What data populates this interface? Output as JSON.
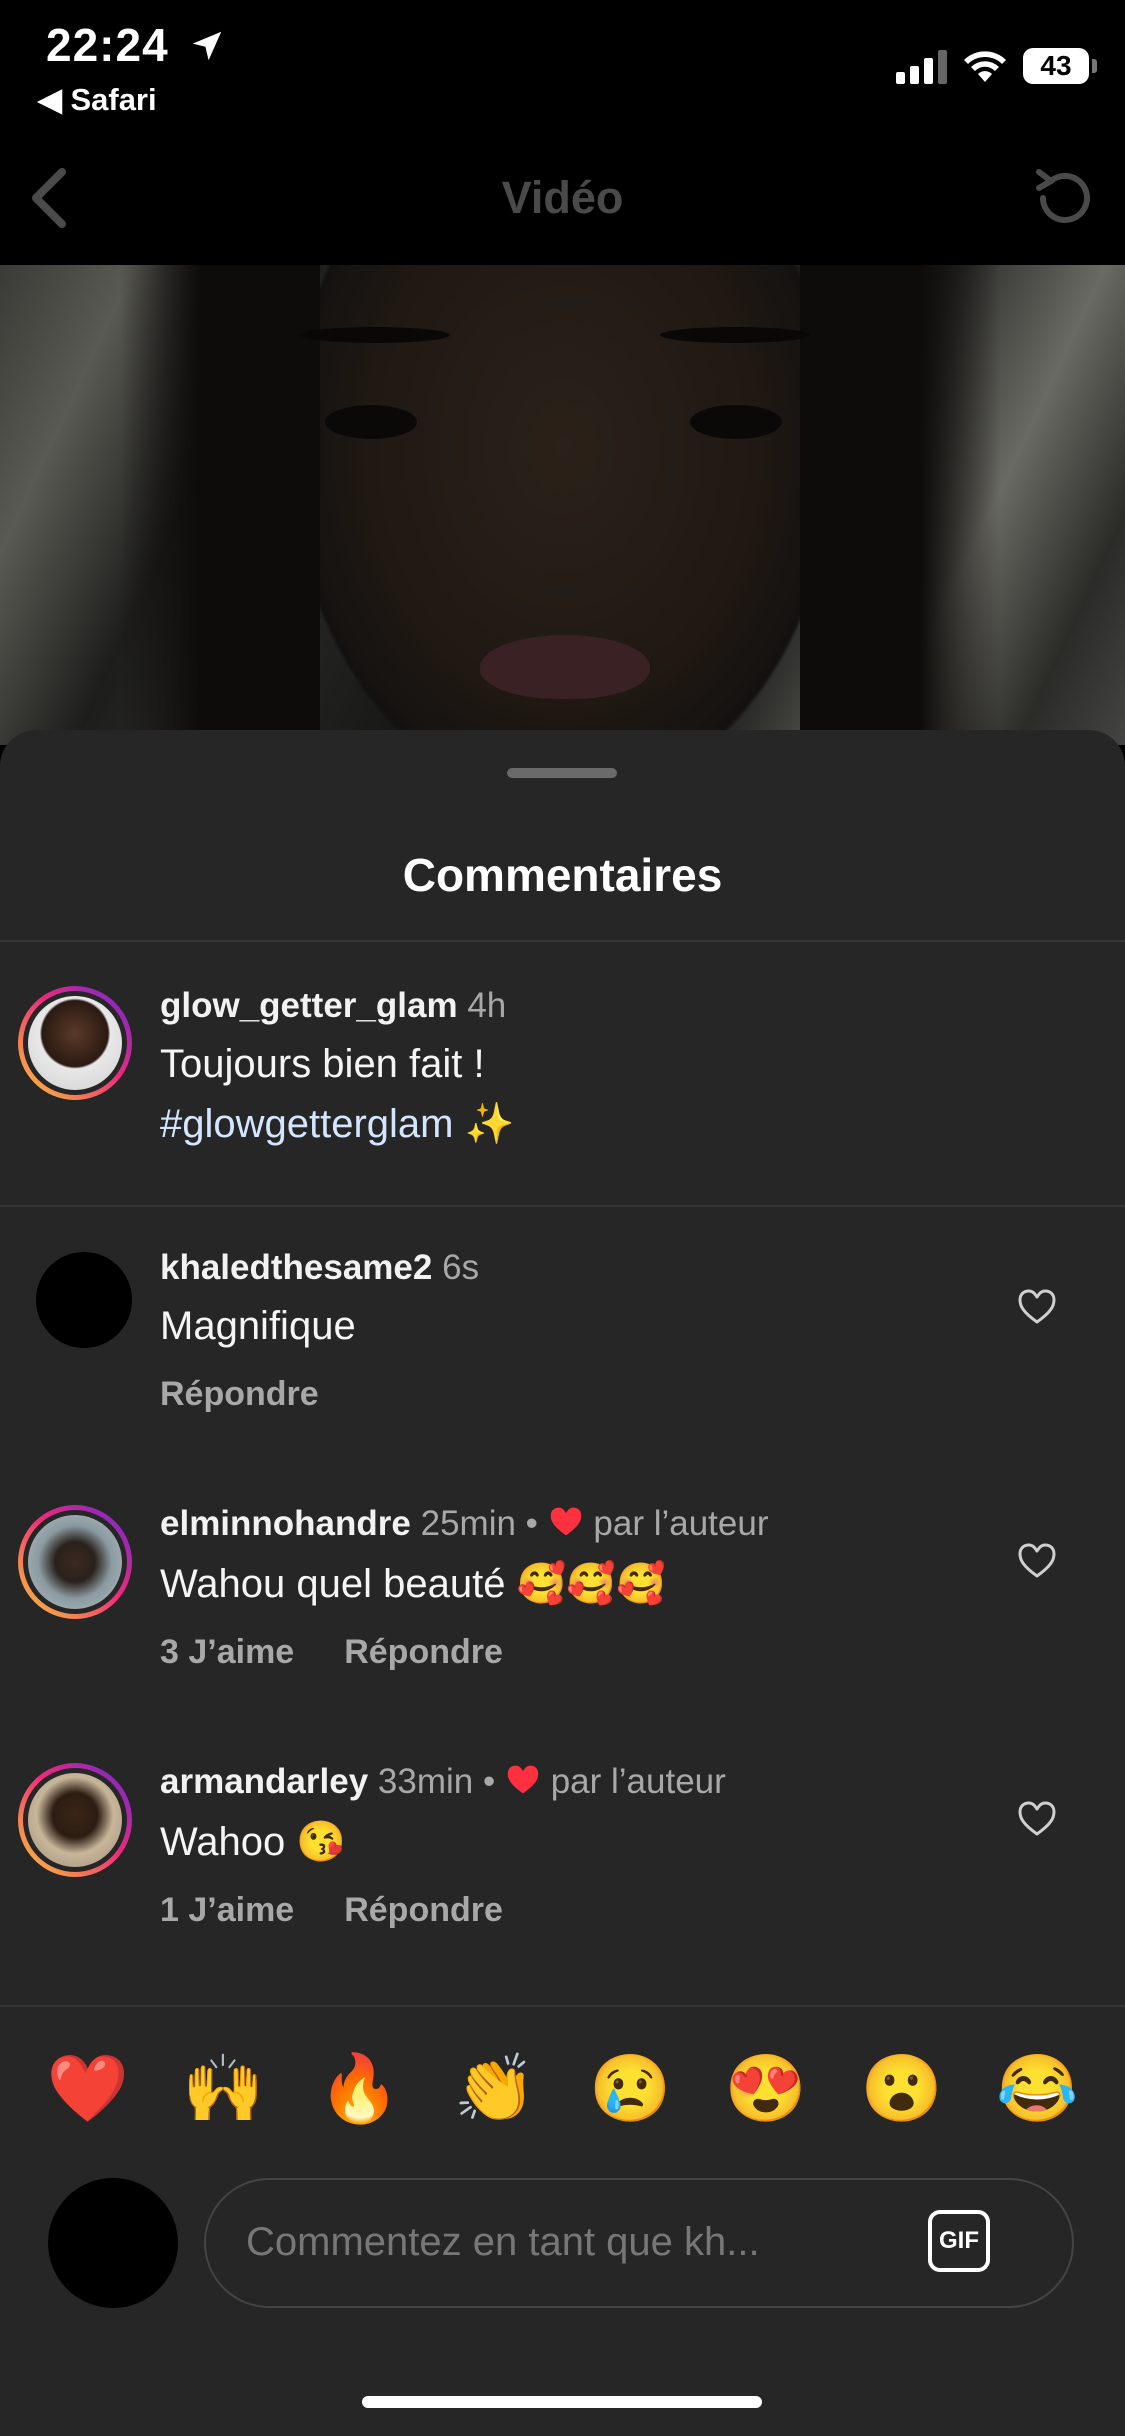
{
  "status_bar": {
    "time": "22:24",
    "back_app": "◀ Safari",
    "battery": "43"
  },
  "nav": {
    "title": "Vidéo"
  },
  "sheet": {
    "title": "Commentaires"
  },
  "caption": {
    "username": "glow_getter_glam",
    "time": "4h",
    "text_line1": "Toujours bien fait !",
    "hashtag": "#glowgetterglam",
    "emoji": "✨"
  },
  "comments": [
    {
      "username": "khaledthesame2",
      "time": "6s",
      "liked_by_author": "",
      "text": "Magnifique",
      "likes": "",
      "reply": "Répondre"
    },
    {
      "username": "elminnohandre",
      "time": "25min •",
      "liked_by_author": "par l’auteur",
      "text": "Wahou quel beauté 🥰🥰🥰",
      "likes": "3 J’aime",
      "reply": "Répondre"
    },
    {
      "username": "armandarley",
      "time": "33min •",
      "liked_by_author": "par l’auteur",
      "text": "Wahoo 😘",
      "likes": "1 J’aime",
      "reply": "Répondre"
    }
  ],
  "reactions": [
    "❤️",
    "🙌",
    "🔥",
    "👏",
    "😢",
    "😍",
    "😮",
    "😂"
  ],
  "composer": {
    "placeholder": "Commentez en tant que kh...",
    "gif_label": "GIF"
  },
  "colors": {
    "background": "#000000",
    "sheet": "#262626",
    "heart": "#ff3040",
    "muted_text": "#a8a8a8",
    "hashtag": "#d4e6ff"
  }
}
